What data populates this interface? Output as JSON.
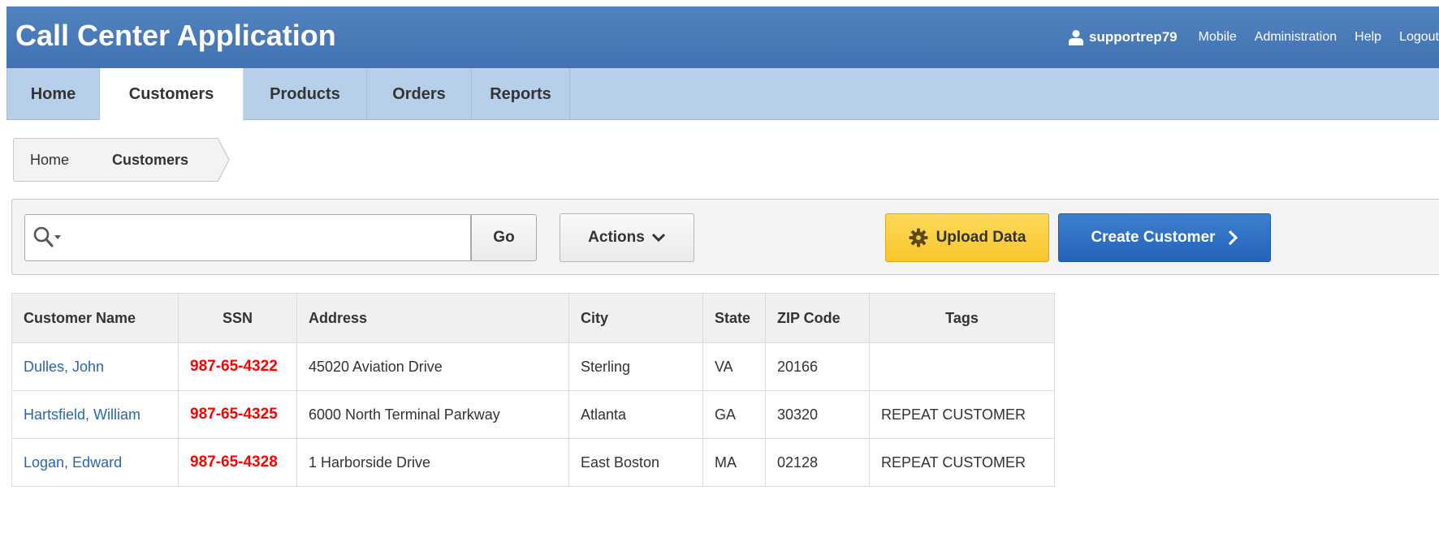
{
  "header": {
    "title": "Call Center Application",
    "username": "supportrep79",
    "links": [
      "Mobile",
      "Administration",
      "Help",
      "Logout"
    ]
  },
  "tabs": [
    {
      "label": "Home",
      "active": false
    },
    {
      "label": "Customers",
      "active": true
    },
    {
      "label": "Products",
      "active": false
    },
    {
      "label": "Orders",
      "active": false
    },
    {
      "label": "Reports",
      "active": false
    }
  ],
  "breadcrumb": [
    "Home",
    "Customers"
  ],
  "toolbar": {
    "search_value": "",
    "search_placeholder": "",
    "go_label": "Go",
    "actions_label": "Actions",
    "upload_label": "Upload Data",
    "create_label": "Create Customer"
  },
  "table": {
    "headers": [
      "Customer Name",
      "SSN",
      "Address",
      "City",
      "State",
      "ZIP Code",
      "Tags"
    ],
    "rows": [
      [
        "Dulles, John",
        "987-65-4322",
        "45020 Aviation Drive",
        "Sterling",
        "VA",
        "20166",
        ""
      ],
      [
        "Hartsfield, William",
        "987-65-4325",
        "6000 North Terminal Parkway",
        "Atlanta",
        "GA",
        "30320",
        "REPEAT CUSTOMER"
      ],
      [
        "Logan, Edward",
        "987-65-4328",
        "1 Harborside Drive",
        "East Boston",
        "MA",
        "02128",
        "REPEAT CUSTOMER"
      ]
    ]
  },
  "colors": {
    "header_bg": "#4a7ab8",
    "tabbar_bg": "#b8cfea",
    "link": "#2b66b0",
    "ssn": "#ff0000",
    "upload_btn": "#f8c72d",
    "create_btn": "#2463b8"
  },
  "icons": {
    "user": "user-icon",
    "search": "search-icon",
    "actions": "chevron-down-icon",
    "upload": "gear-icon",
    "create": "chevron-right-icon"
  }
}
